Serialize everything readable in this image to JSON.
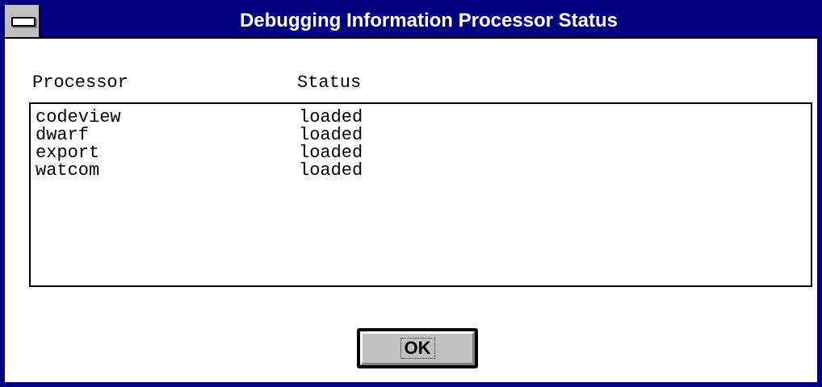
{
  "window": {
    "title": "Debugging Information Processor Status",
    "accent_color": "#000080",
    "system_menu_icon": "system-menu-icon"
  },
  "columns": {
    "processor": "Processor",
    "status": "Status"
  },
  "rows": [
    {
      "processor": "codeview",
      "status": "loaded"
    },
    {
      "processor": "dwarf",
      "status": "loaded"
    },
    {
      "processor": "export",
      "status": "loaded"
    },
    {
      "processor": "watcom",
      "status": "loaded"
    }
  ],
  "buttons": {
    "ok_label": "OK"
  }
}
